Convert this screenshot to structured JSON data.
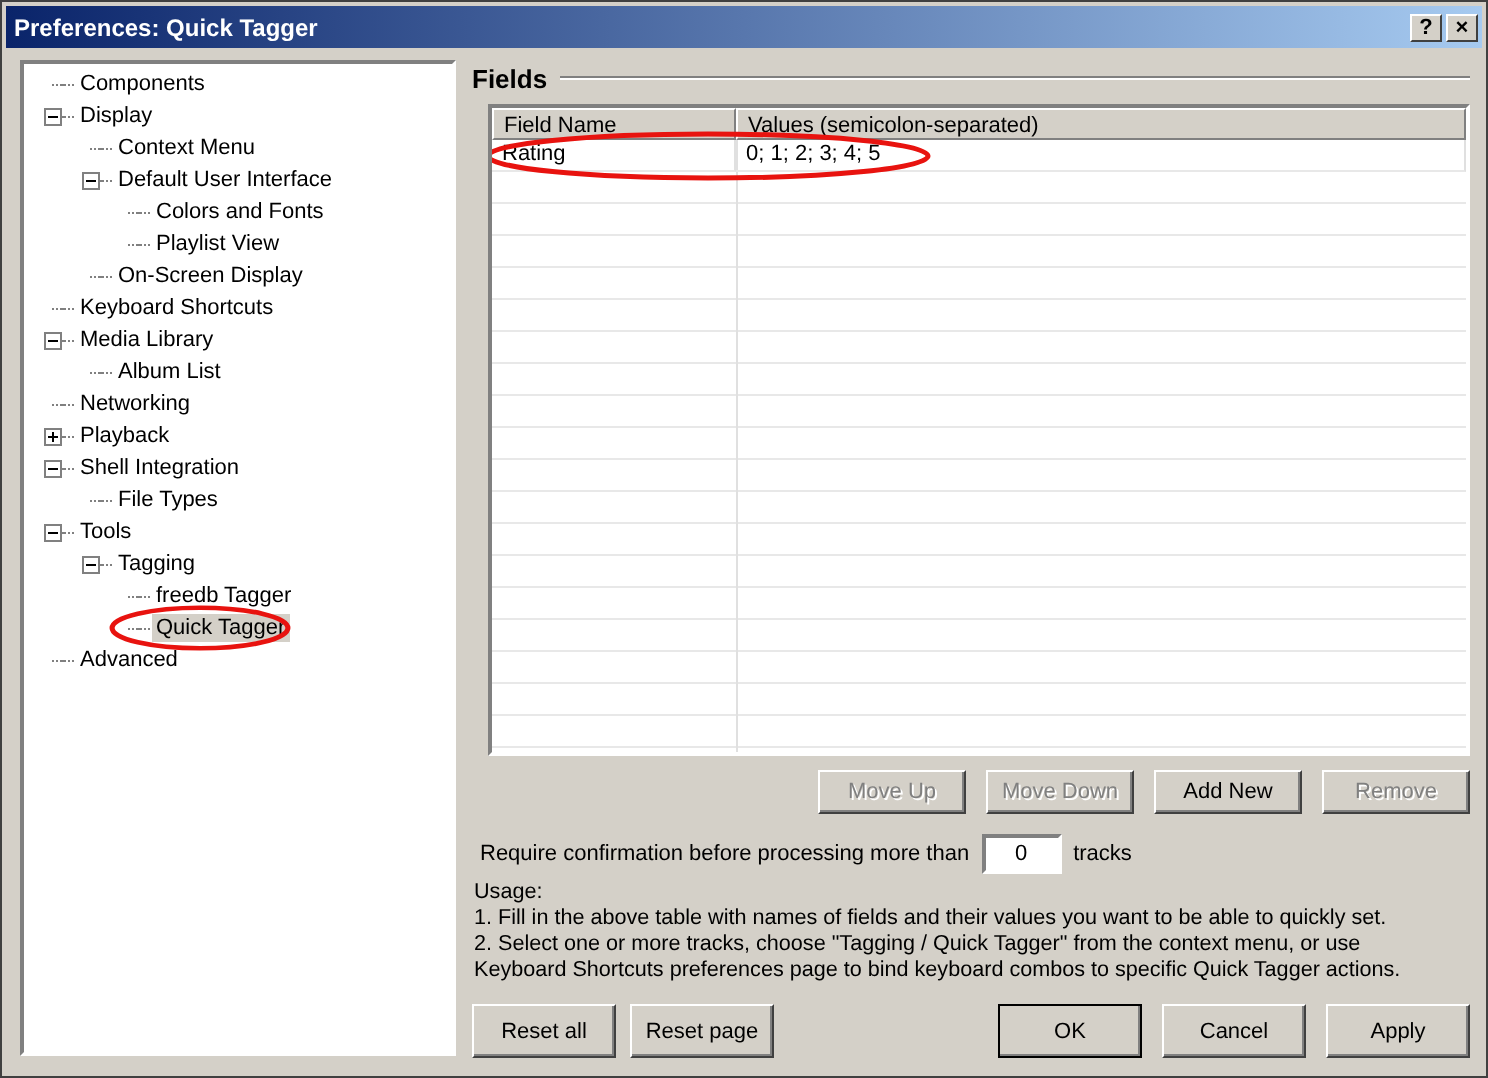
{
  "window": {
    "title": "Preferences: Quick Tagger",
    "buttons": [
      "?",
      "×"
    ]
  },
  "tree": [
    {
      "label": "Components",
      "selected": false
    },
    {
      "label": "Display",
      "selected": false,
      "expanded": true,
      "children": [
        {
          "label": "Context Menu",
          "selected": false
        },
        {
          "label": "Default User Interface",
          "selected": false,
          "expanded": true,
          "children": [
            {
              "label": "Colors and Fonts",
              "selected": false
            },
            {
              "label": "Playlist View",
              "selected": false
            }
          ]
        },
        {
          "label": "On-Screen Display",
          "selected": false
        }
      ]
    },
    {
      "label": "Keyboard Shortcuts",
      "selected": false
    },
    {
      "label": "Media Library",
      "selected": false,
      "expanded": true,
      "children": [
        {
          "label": "Album List",
          "selected": false
        }
      ]
    },
    {
      "label": "Networking",
      "selected": false
    },
    {
      "label": "Playback",
      "selected": false,
      "expanded": false
    },
    {
      "label": "Shell Integration",
      "selected": false,
      "expanded": true,
      "children": [
        {
          "label": "File Types",
          "selected": false
        }
      ]
    },
    {
      "label": "Tools",
      "selected": false,
      "expanded": true,
      "children": [
        {
          "label": "Tagging",
          "selected": false,
          "expanded": true,
          "children": [
            {
              "label": "freedb Tagger",
              "selected": false
            },
            {
              "label": "Quick Tagger",
              "selected": true,
              "highlighted": true
            }
          ]
        }
      ]
    },
    {
      "label": "Advanced",
      "selected": false
    }
  ],
  "section_title": "Fields",
  "table": {
    "columns": [
      "Field Name",
      "Values (semicolon-separated)"
    ],
    "rows": [
      {
        "cells": [
          "Rating",
          "0; 1; 2; 3; 4; 5"
        ],
        "highlighted": true
      }
    ]
  },
  "table_buttons": [
    {
      "label": "Move Up",
      "disabled": true
    },
    {
      "label": "Move Down",
      "disabled": true
    },
    {
      "label": "Add New",
      "disabled": false
    },
    {
      "label": "Remove",
      "disabled": true
    }
  ],
  "confirmation": {
    "label": "Require confirmation before processing more than",
    "value": "0",
    "suffix": "tracks"
  },
  "usage": [
    "Usage:",
    "1. Fill in the above table with names of fields and their values you want to be able to quickly set.",
    "2. Select one or more tracks, choose \"Tagging / Quick Tagger\" from the context menu, or use",
    "Keyboard Shortcuts preferences page to bind keyboard combos to specific Quick Tagger actions."
  ],
  "footer_left": [
    "Reset all",
    "Reset page"
  ],
  "footer_right": [
    {
      "label": "OK",
      "default": true
    },
    {
      "label": "Cancel",
      "default": false
    },
    {
      "label": "Apply",
      "default": false
    }
  ]
}
